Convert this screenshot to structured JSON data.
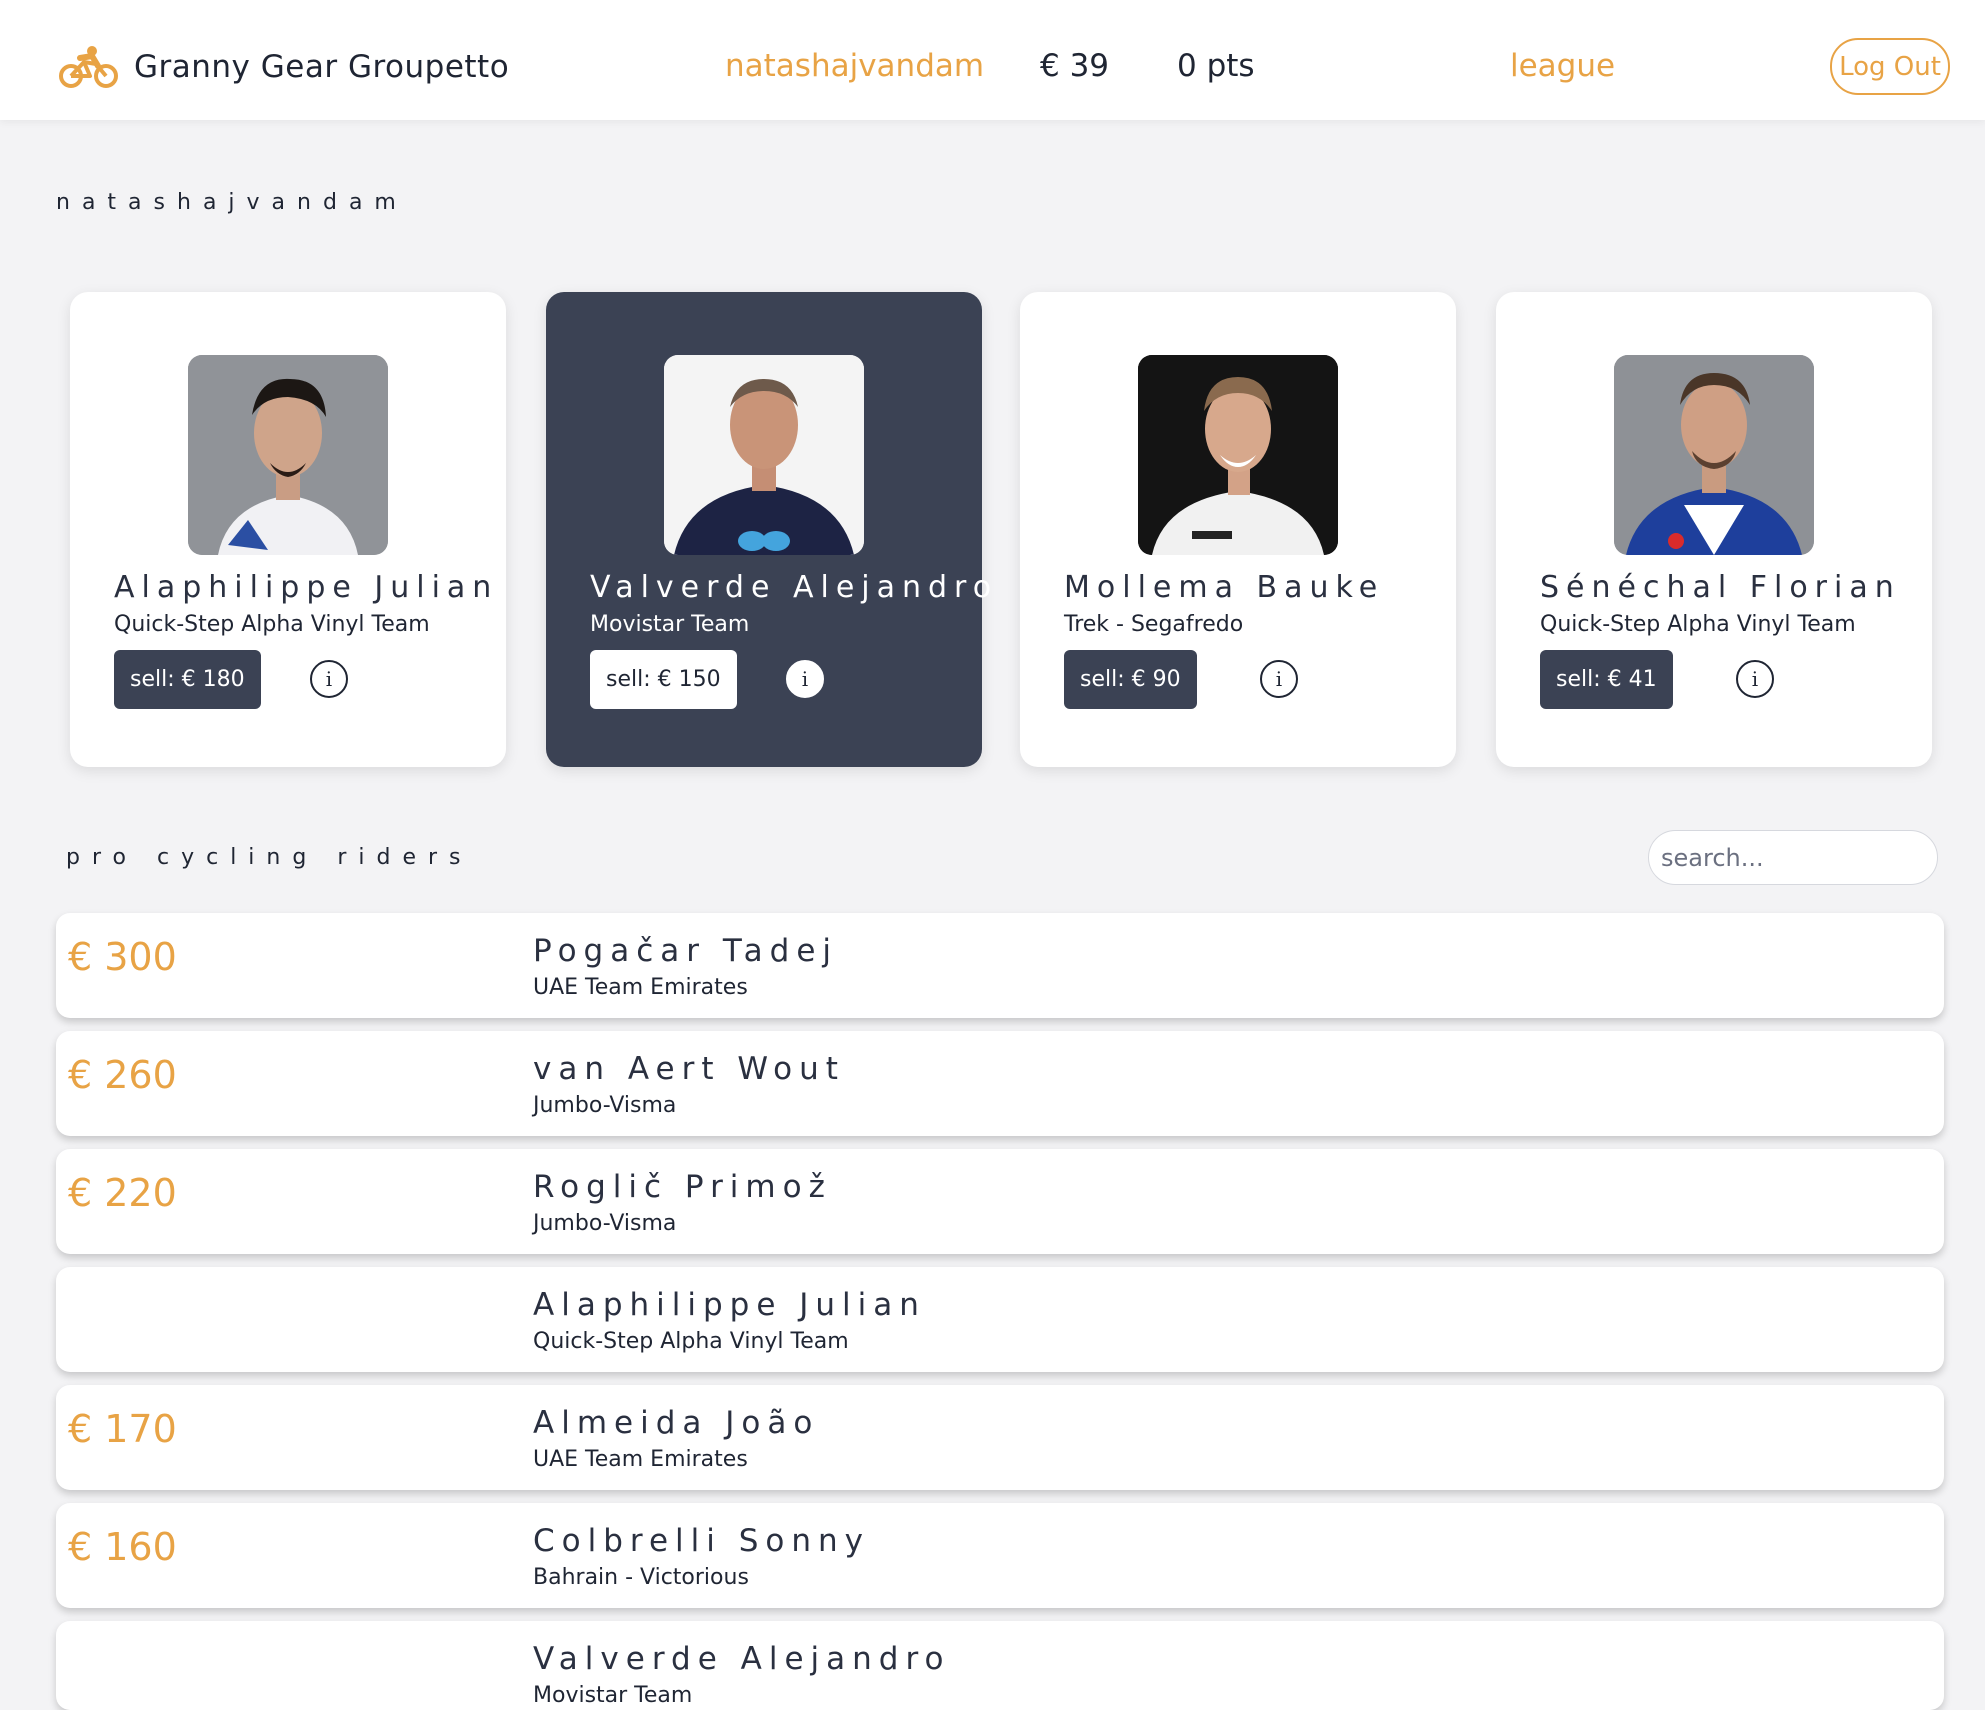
{
  "header": {
    "brand": "Granny Gear Groupetto",
    "username": "natashajvandam",
    "budget": "€ 39",
    "points": "0 pts",
    "league": "league",
    "logout": "Log Out"
  },
  "my_team": {
    "title": "natashajvandam",
    "riders": [
      {
        "name": "Alaphilippe Julian",
        "team": "Quick-Step Alpha Vinyl Team",
        "sell": "sell: € 180",
        "info": "i",
        "photo_icon": "rider-photo",
        "selected": false
      },
      {
        "name": "Valverde Alejandro",
        "team": "Movistar Team",
        "sell": "sell: € 150",
        "info": "i",
        "photo_icon": "rider-photo",
        "selected": true
      },
      {
        "name": "Mollema Bauke",
        "team": "Trek - Segafredo",
        "sell": "sell: € 90",
        "info": "i",
        "photo_icon": "rider-photo",
        "selected": false
      },
      {
        "name": "Sénéchal Florian",
        "team": "Quick-Step Alpha Vinyl Team",
        "sell": "sell: € 41",
        "info": "i",
        "photo_icon": "rider-photo",
        "selected": false
      }
    ]
  },
  "pro_riders": {
    "title": "pro cycling riders",
    "search_placeholder": "search...",
    "rows": [
      {
        "price": "€ 300",
        "name": "Pogačar Tadej",
        "team": "UAE Team Emirates"
      },
      {
        "price": "€ 260",
        "name": "van Aert Wout",
        "team": "Jumbo-Visma"
      },
      {
        "price": "€ 220",
        "name": "Roglič Primož",
        "team": "Jumbo-Visma"
      },
      {
        "price": "",
        "name": "Alaphilippe Julian",
        "team": "Quick-Step Alpha Vinyl Team"
      },
      {
        "price": "€ 170",
        "name": "Almeida João",
        "team": "UAE Team Emirates"
      },
      {
        "price": "€ 160",
        "name": "Colbrelli Sonny",
        "team": "Bahrain - Victorious"
      },
      {
        "price": "",
        "name": "Valverde Alejandro",
        "team": "Movistar Team"
      }
    ]
  },
  "colors": {
    "accent": "#e8a345",
    "dark_card": "#3b4254",
    "text": "#1f2533",
    "background": "#f3f3f5"
  }
}
